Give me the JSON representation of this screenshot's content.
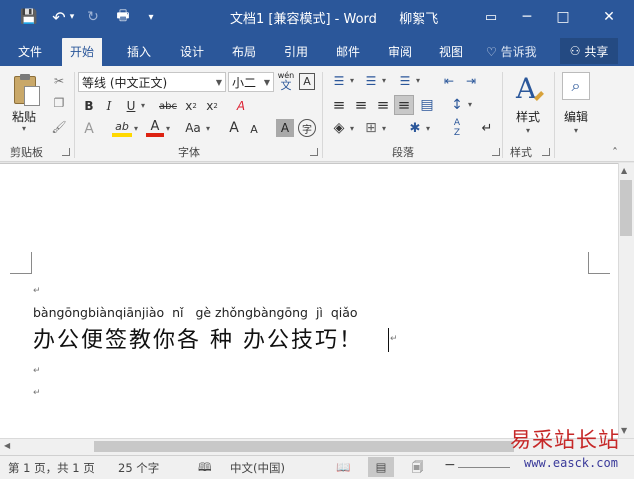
{
  "window": {
    "title": "文档1 [兼容模式] - Word",
    "user": "柳絮飞",
    "minimize_glyph": "─",
    "restore_glyph": "□",
    "close_glyph": "✕",
    "ribbon_display_glyph": "▭"
  },
  "quick_access": {
    "save_glyph": "💾",
    "undo_glyph": "↶",
    "undo_caret": "▾",
    "redo_glyph": "↻",
    "print_glyph": "🖶",
    "customize_glyph": "▾"
  },
  "tabs": [
    {
      "label": "文件"
    },
    {
      "label": "开始"
    },
    {
      "label": "插入"
    },
    {
      "label": "设计"
    },
    {
      "label": "布局"
    },
    {
      "label": "引用"
    },
    {
      "label": "邮件"
    },
    {
      "label": "审阅"
    },
    {
      "label": "视图"
    }
  ],
  "tellme": {
    "label": "告诉我",
    "icon_glyph": "♡"
  },
  "share": {
    "label": "共享",
    "icon_glyph": "⚇"
  },
  "clipboard": {
    "group_label": "剪贴板",
    "paste_label": "粘贴",
    "paste_caret": "▾",
    "cut_glyph": "✂",
    "copy_glyph": "❐",
    "format_painter_glyph": "🖌"
  },
  "font": {
    "group_label": "字体",
    "font_name": "等线 (中文正文)",
    "font_size": "小二",
    "phonetic_top": "wén",
    "phonetic_bottom": "文",
    "char_border": "A",
    "bold": "B",
    "italic": "I",
    "underline": "U",
    "strike": "abc",
    "subscript_base": "x",
    "subscript_mark": "2",
    "superscript_base": "x",
    "superscript_mark": "2",
    "clear_format": "A",
    "text_effects": "A",
    "highlight": "ab",
    "font_color": "A",
    "change_case": "Aa",
    "grow": "A",
    "shrink": "A",
    "char_shading": "A",
    "enclose": "字"
  },
  "paragraph": {
    "group_label": "段落",
    "bullets_glyph": "☰",
    "numbering_glyph": "☰",
    "multilevel_glyph": "☰",
    "decrease_indent_glyph": "⇤",
    "increase_indent_glyph": "⇥",
    "align_left_glyph": "≡",
    "center_glyph": "≡",
    "align_right_glyph": "≡",
    "justify_glyph": "≡",
    "distribute_glyph": "▤",
    "line_spacing_glyph": "↕",
    "shading_glyph": "◈",
    "borders_glyph": "⊞",
    "asian_layout_glyph": "✱",
    "sort_top": "A",
    "sort_bottom": "Z",
    "show_marks_glyph": "↵"
  },
  "styles": {
    "group_label": "样式",
    "label": "样式",
    "icon_glyph": "A"
  },
  "editing": {
    "label": "编辑",
    "icon_glyph": "⌕"
  },
  "collapse_ribbon_glyph": "ˆ",
  "document": {
    "paragraph_mark": "↵",
    "pinyin_line": "bàngōngbiànqiānjiào  nǐ   gè zhǒngbàngōng  jì  qiǎo",
    "text_line": "办公便签教你各 种 办公技巧！"
  },
  "status": {
    "page": "第 1 页，共 1 页",
    "words": "25 个字",
    "proof_glyph": "🕮",
    "language": "中文(中国)",
    "read_mode_glyph": "📖",
    "print_layout_glyph": "▤",
    "web_layout_glyph": "🗐",
    "zoom_out": "−"
  },
  "watermark": {
    "name": "易采站长站",
    "url": "www.easck.com"
  }
}
